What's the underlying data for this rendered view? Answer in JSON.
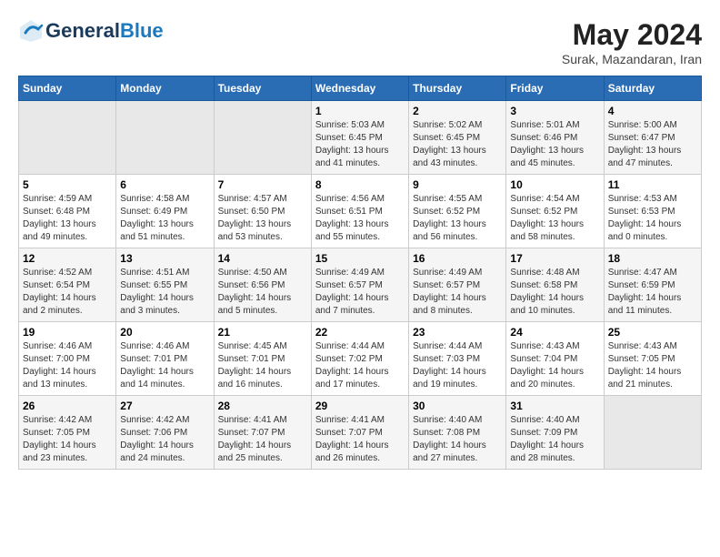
{
  "header": {
    "logo_line1": "General",
    "logo_line2": "Blue",
    "month_year": "May 2024",
    "location": "Surak, Mazandaran, Iran"
  },
  "days_of_week": [
    "Sunday",
    "Monday",
    "Tuesday",
    "Wednesday",
    "Thursday",
    "Friday",
    "Saturday"
  ],
  "weeks": [
    [
      {
        "day": "",
        "info": ""
      },
      {
        "day": "",
        "info": ""
      },
      {
        "day": "",
        "info": ""
      },
      {
        "day": "1",
        "info": "Sunrise: 5:03 AM\nSunset: 6:45 PM\nDaylight: 13 hours\nand 41 minutes."
      },
      {
        "day": "2",
        "info": "Sunrise: 5:02 AM\nSunset: 6:45 PM\nDaylight: 13 hours\nand 43 minutes."
      },
      {
        "day": "3",
        "info": "Sunrise: 5:01 AM\nSunset: 6:46 PM\nDaylight: 13 hours\nand 45 minutes."
      },
      {
        "day": "4",
        "info": "Sunrise: 5:00 AM\nSunset: 6:47 PM\nDaylight: 13 hours\nand 47 minutes."
      }
    ],
    [
      {
        "day": "5",
        "info": "Sunrise: 4:59 AM\nSunset: 6:48 PM\nDaylight: 13 hours\nand 49 minutes."
      },
      {
        "day": "6",
        "info": "Sunrise: 4:58 AM\nSunset: 6:49 PM\nDaylight: 13 hours\nand 51 minutes."
      },
      {
        "day": "7",
        "info": "Sunrise: 4:57 AM\nSunset: 6:50 PM\nDaylight: 13 hours\nand 53 minutes."
      },
      {
        "day": "8",
        "info": "Sunrise: 4:56 AM\nSunset: 6:51 PM\nDaylight: 13 hours\nand 55 minutes."
      },
      {
        "day": "9",
        "info": "Sunrise: 4:55 AM\nSunset: 6:52 PM\nDaylight: 13 hours\nand 56 minutes."
      },
      {
        "day": "10",
        "info": "Sunrise: 4:54 AM\nSunset: 6:52 PM\nDaylight: 13 hours\nand 58 minutes."
      },
      {
        "day": "11",
        "info": "Sunrise: 4:53 AM\nSunset: 6:53 PM\nDaylight: 14 hours\nand 0 minutes."
      }
    ],
    [
      {
        "day": "12",
        "info": "Sunrise: 4:52 AM\nSunset: 6:54 PM\nDaylight: 14 hours\nand 2 minutes."
      },
      {
        "day": "13",
        "info": "Sunrise: 4:51 AM\nSunset: 6:55 PM\nDaylight: 14 hours\nand 3 minutes."
      },
      {
        "day": "14",
        "info": "Sunrise: 4:50 AM\nSunset: 6:56 PM\nDaylight: 14 hours\nand 5 minutes."
      },
      {
        "day": "15",
        "info": "Sunrise: 4:49 AM\nSunset: 6:57 PM\nDaylight: 14 hours\nand 7 minutes."
      },
      {
        "day": "16",
        "info": "Sunrise: 4:49 AM\nSunset: 6:57 PM\nDaylight: 14 hours\nand 8 minutes."
      },
      {
        "day": "17",
        "info": "Sunrise: 4:48 AM\nSunset: 6:58 PM\nDaylight: 14 hours\nand 10 minutes."
      },
      {
        "day": "18",
        "info": "Sunrise: 4:47 AM\nSunset: 6:59 PM\nDaylight: 14 hours\nand 11 minutes."
      }
    ],
    [
      {
        "day": "19",
        "info": "Sunrise: 4:46 AM\nSunset: 7:00 PM\nDaylight: 14 hours\nand 13 minutes."
      },
      {
        "day": "20",
        "info": "Sunrise: 4:46 AM\nSunset: 7:01 PM\nDaylight: 14 hours\nand 14 minutes."
      },
      {
        "day": "21",
        "info": "Sunrise: 4:45 AM\nSunset: 7:01 PM\nDaylight: 14 hours\nand 16 minutes."
      },
      {
        "day": "22",
        "info": "Sunrise: 4:44 AM\nSunset: 7:02 PM\nDaylight: 14 hours\nand 17 minutes."
      },
      {
        "day": "23",
        "info": "Sunrise: 4:44 AM\nSunset: 7:03 PM\nDaylight: 14 hours\nand 19 minutes."
      },
      {
        "day": "24",
        "info": "Sunrise: 4:43 AM\nSunset: 7:04 PM\nDaylight: 14 hours\nand 20 minutes."
      },
      {
        "day": "25",
        "info": "Sunrise: 4:43 AM\nSunset: 7:05 PM\nDaylight: 14 hours\nand 21 minutes."
      }
    ],
    [
      {
        "day": "26",
        "info": "Sunrise: 4:42 AM\nSunset: 7:05 PM\nDaylight: 14 hours\nand 23 minutes."
      },
      {
        "day": "27",
        "info": "Sunrise: 4:42 AM\nSunset: 7:06 PM\nDaylight: 14 hours\nand 24 minutes."
      },
      {
        "day": "28",
        "info": "Sunrise: 4:41 AM\nSunset: 7:07 PM\nDaylight: 14 hours\nand 25 minutes."
      },
      {
        "day": "29",
        "info": "Sunrise: 4:41 AM\nSunset: 7:07 PM\nDaylight: 14 hours\nand 26 minutes."
      },
      {
        "day": "30",
        "info": "Sunrise: 4:40 AM\nSunset: 7:08 PM\nDaylight: 14 hours\nand 27 minutes."
      },
      {
        "day": "31",
        "info": "Sunrise: 4:40 AM\nSunset: 7:09 PM\nDaylight: 14 hours\nand 28 minutes."
      },
      {
        "day": "",
        "info": ""
      }
    ]
  ]
}
